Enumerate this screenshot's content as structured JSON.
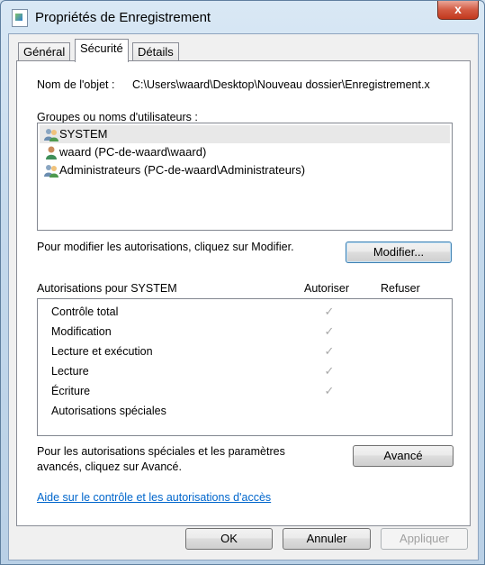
{
  "window": {
    "title": "Propriétés de Enregistrement",
    "close_glyph": "x"
  },
  "tabs": [
    {
      "label": "Général"
    },
    {
      "label": "Sécurité"
    },
    {
      "label": "Détails"
    }
  ],
  "security": {
    "object_name_label": "Nom de l'objet :",
    "object_name_value": "C:\\Users\\waard\\Desktop\\Nouveau dossier\\Enregistrement.x",
    "groups_label": "Groupes ou noms d'utilisateurs :",
    "users": [
      {
        "label": "SYSTEM",
        "icon": "group-icon"
      },
      {
        "label": "waard (PC-de-waard\\waard)",
        "icon": "user-icon"
      },
      {
        "label": "Administrateurs (PC-de-waard\\Administrateurs)",
        "icon": "group-icon"
      }
    ],
    "modify_hint": "Pour modifier les autorisations, cliquez sur Modifier.",
    "modify_button": "Modifier...",
    "permissions_for": "Autorisations pour SYSTEM",
    "allow_header": "Autoriser",
    "deny_header": "Refuser",
    "permissions": [
      {
        "name": "Contrôle total",
        "allow": "✓",
        "deny": ""
      },
      {
        "name": "Modification",
        "allow": "✓",
        "deny": ""
      },
      {
        "name": "Lecture et exécution",
        "allow": "✓",
        "deny": ""
      },
      {
        "name": "Lecture",
        "allow": "✓",
        "deny": ""
      },
      {
        "name": "Écriture",
        "allow": "✓",
        "deny": ""
      },
      {
        "name": "Autorisations spéciales",
        "allow": "",
        "deny": ""
      }
    ],
    "advanced_hint_line1": "Pour les autorisations spéciales et les paramètres",
    "advanced_hint_line2": "avancés, cliquez sur Avancé.",
    "advanced_button": "Avancé",
    "help_link": "Aide sur le contrôle et les autorisations d'accès"
  },
  "buttons": {
    "ok": "OK",
    "cancel": "Annuler",
    "apply": "Appliquer"
  },
  "colors": {
    "link": "#0066cc",
    "close": "#c2381d"
  }
}
